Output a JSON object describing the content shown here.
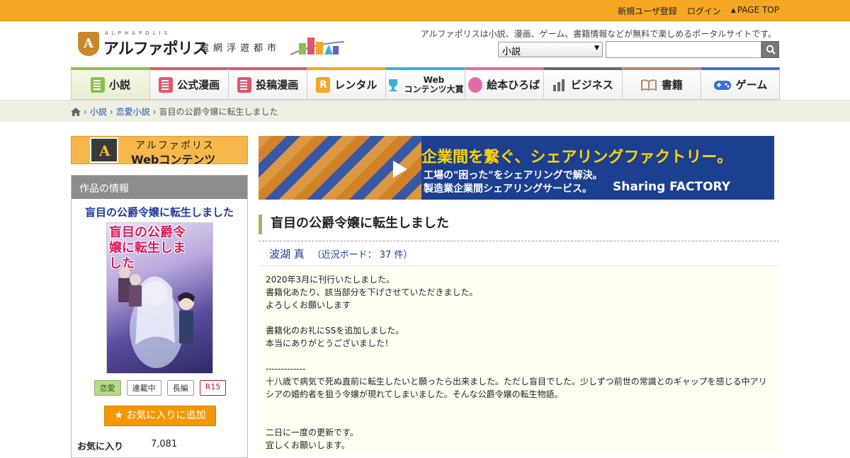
{
  "topbar": {
    "register": "新規ユーザ登録",
    "login": "ログイン",
    "page_top": "PAGE TOP"
  },
  "header": {
    "logo_small": "ALPHAPOLIS",
    "logo_name": "アルファポリス",
    "logo_sub": "電網浮遊都市",
    "tagline": "アルファポリスは小説、漫画、ゲーム、書籍情報などが無料で楽しめるポータルサイトです。",
    "search_category": "小説",
    "search_value": ""
  },
  "nav": {
    "items": [
      {
        "label": "小説",
        "icon": "book-icon",
        "color": "#8cbf4f"
      },
      {
        "label": "公式漫画",
        "icon": "manga-icon",
        "color": "#e0566a"
      },
      {
        "label": "投稿漫画",
        "icon": "manga-icon",
        "color": "#e0566a"
      },
      {
        "label": "レンタル",
        "icon": "rental-icon",
        "color": "#f5a623"
      },
      {
        "label": "Web\nコンテンツ大賞",
        "icon": "trophy-icon",
        "color": "#3ab0d6"
      },
      {
        "label": "絵本ひろば",
        "icon": "picturebook-icon",
        "color": "#e66aa8"
      },
      {
        "label": "ビジネス",
        "icon": "chart-icon",
        "color": "#666666"
      },
      {
        "label": "書籍",
        "icon": "open-book-icon",
        "color": "#b58a6a"
      },
      {
        "label": "ゲーム",
        "icon": "gamepad-icon",
        "color": "#3a6fd8"
      }
    ]
  },
  "breadcrumb": {
    "items": [
      "小説",
      "恋愛小説",
      "盲目の公爵令嬢に転生しました"
    ]
  },
  "sidebar": {
    "banner_line1": "アルファポリス",
    "banner_line2": "Webコンテンツ",
    "info_heading": "作品の情報",
    "title": "盲目の公爵令嬢に転生しました",
    "cover_text": "盲目の公爵令嬢に転生しました",
    "tags": [
      "恋愛",
      "連載中",
      "長編",
      "R15"
    ],
    "fav_button": "お気に入りに追加",
    "stat_label": "お気に入り",
    "stat_value": "7,081"
  },
  "ad": {
    "headline": "企業間を繋ぐ、シェアリングファクトリー。",
    "line2": "工場の\"困った\"をシェアリングで解決。",
    "line3": "製造業企業間シェアリングサービス。",
    "brand": "Sharing FACTORY"
  },
  "work": {
    "title": "盲目の公爵令嬢に転生しました",
    "author": "波湖 真",
    "board_count": "（近況ボード： 37 件）",
    "description": [
      "2020年3月に刊行いたしました。",
      "書籍化あたり、該当部分を下げさせていただきました。",
      "よろしくお願いします",
      "",
      "書籍化のお礼にSSを追加しました。",
      "本当にありがとうございました！",
      "",
      "-------------",
      "十八歳で病気で死ぬ直前に転生したいと願ったら出来ました。ただし盲目でした。少しずつ前世の常識とのギャップを感じる中アリ",
      "シアの婚約者を狙う令嬢が現れてしまいました。そんな公爵令嬢の転生物語。",
      "",
      "",
      "二日に一度の更新です。",
      "宜しくお願いします。"
    ]
  }
}
